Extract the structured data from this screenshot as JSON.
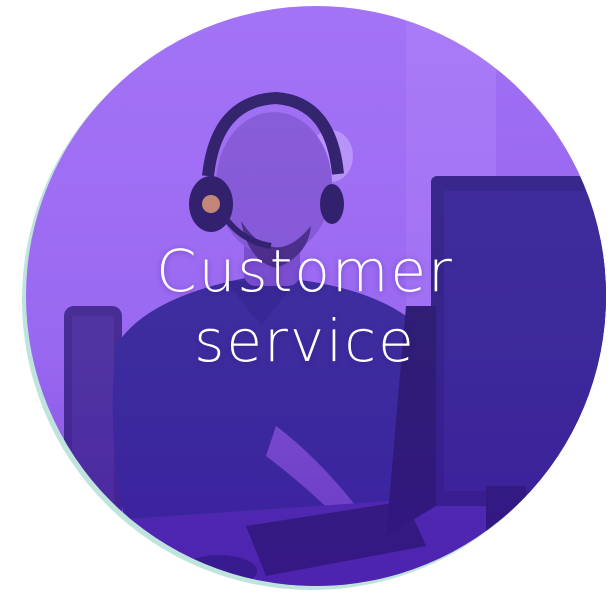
{
  "card": {
    "title_line1": "Customer",
    "title_line2": "service",
    "photo_subject": "agent-with-headset-at-computer",
    "colors": {
      "tint_light": "#a070f2",
      "tint_deep": "#5a22c8",
      "ring": "#bfe3dd",
      "text": "#ffffff"
    }
  }
}
